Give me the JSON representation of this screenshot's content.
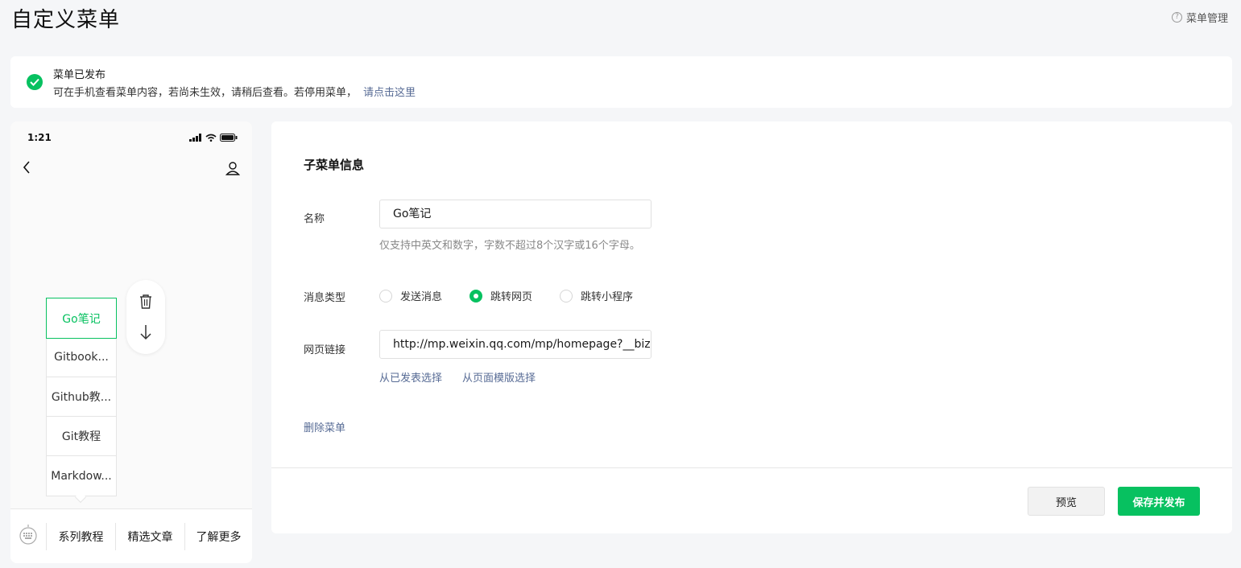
{
  "header": {
    "title": "自定义菜单",
    "help_link": "菜单管理",
    "help_icon": "question-circle-icon"
  },
  "notice": {
    "title": "菜单已发布",
    "message": "可在手机查看菜单内容，若尚未生效，请稍后查看。若停用菜单，",
    "link": "请点击这里",
    "icon": "check-circle-icon"
  },
  "phone": {
    "time": "1:21",
    "submenu": [
      {
        "label": "Go笔记",
        "active": true
      },
      {
        "label": "Gitbook..."
      },
      {
        "label": "Github教..."
      },
      {
        "label": "Git教程"
      },
      {
        "label": "Markdow..."
      }
    ],
    "bottom_menu": [
      {
        "label": "系列教程"
      },
      {
        "label": "精选文章"
      },
      {
        "label": "了解更多"
      }
    ]
  },
  "form": {
    "section_title": "子菜单信息",
    "name_label": "名称",
    "name_value": "Go笔记",
    "name_hint": "仅支持中英文和数字，字数不超过8个汉字或16个字母。",
    "type_label": "消息类型",
    "type_options": [
      {
        "label": "发送消息",
        "selected": false
      },
      {
        "label": "跳转网页",
        "selected": true
      },
      {
        "label": "跳转小程序",
        "selected": false
      }
    ],
    "url_label": "网页链接",
    "url_value": "http://mp.weixin.qq.com/mp/homepage?__biz",
    "pick_published": "从已发表选择",
    "pick_template": "从页面模版选择",
    "delete_menu": "删除菜单"
  },
  "actions": {
    "preview": "预览",
    "save_publish": "保存并发布"
  },
  "colors": {
    "accent": "#07c160",
    "link": "#576b95",
    "background": "#f5f6f8"
  }
}
